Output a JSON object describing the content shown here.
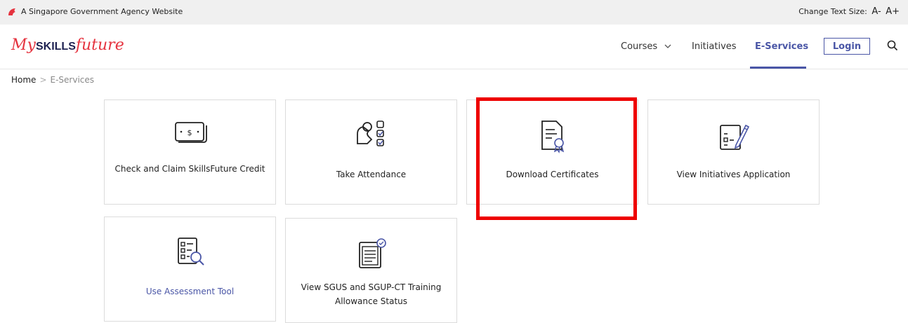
{
  "gov_bar": {
    "text": "A Singapore Government Agency Website",
    "text_size_label": "Change Text Size:",
    "decrease": "A-",
    "increase": "A+"
  },
  "header": {
    "logo": {
      "my": "My",
      "skills": "SKILLS",
      "future": "future"
    },
    "nav": {
      "courses": "Courses",
      "initiatives": "Initiatives",
      "eservices": "E-Services",
      "login": "Login"
    }
  },
  "breadcrumb": {
    "home": "Home",
    "current": "E-Services"
  },
  "cards": [
    {
      "label": "Check and Claim SkillsFuture Credit",
      "icon": "credit-card-icon"
    },
    {
      "label": "Take Attendance",
      "icon": "attendance-icon"
    },
    {
      "label": "Download Certificates",
      "icon": "certificate-icon"
    },
    {
      "label": "View Initiatives Application",
      "icon": "application-icon"
    },
    {
      "label": "Use Assessment Tool",
      "icon": "assessment-icon"
    },
    {
      "label": "View SGUS and SGUP-CT Training Allowance Status",
      "icon": "allowance-status-icon"
    }
  ],
  "colors": {
    "accent": "#4a56a6",
    "brand_red": "#e5333f",
    "highlight": "#ee0000"
  }
}
